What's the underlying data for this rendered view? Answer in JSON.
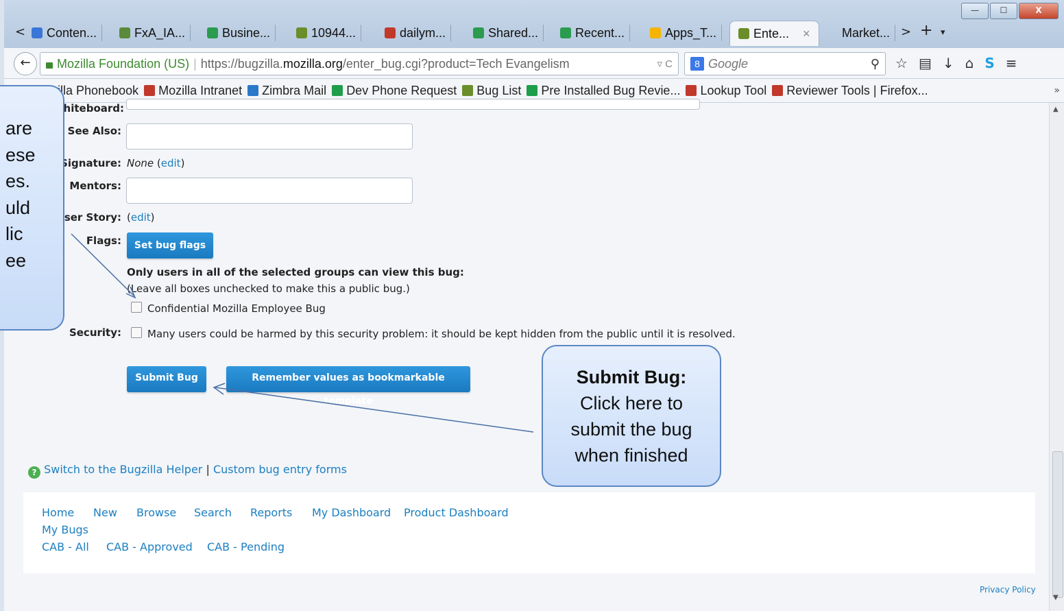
{
  "tabs": [
    {
      "label": "Conten...",
      "icon": "docs-icon",
      "color": "#3a76d8"
    },
    {
      "label": "FxA_IA...",
      "icon": "check-icon",
      "color": "#5a8a3a"
    },
    {
      "label": "Busine...",
      "icon": "drive-icon",
      "color": "#2a9b4f"
    },
    {
      "label": "10944...",
      "icon": "bugzilla-icon",
      "color": "#6a8e2a"
    },
    {
      "label": "dailym...",
      "icon": "mozilla-icon",
      "color": "#c0392b"
    },
    {
      "label": "Shared...",
      "icon": "drive-icon",
      "color": "#2a9b4f"
    },
    {
      "label": "Recent...",
      "icon": "drive-icon",
      "color": "#2a9b4f"
    },
    {
      "label": "Apps_T...",
      "icon": "slides-icon",
      "color": "#f4b400"
    },
    {
      "label": "Ente...",
      "icon": "bugzilla-icon",
      "color": "#6a8e2a",
      "active": true
    },
    {
      "label": "Market...",
      "icon": "",
      "color": ""
    }
  ],
  "tab_close": "×",
  "tab_controls": {
    "prev": "<",
    "next": ">",
    "new": "+",
    "list": "▾"
  },
  "window_controls": {
    "minimize": "—",
    "maximize": "☐",
    "close": "X"
  },
  "nav": {
    "security_label": "Mozilla Foundation (US)",
    "url_prefix": "https://bugzilla.",
    "url_domain": "mozilla.org",
    "url_path": "/enter_bug.cgi?product=Tech Evangelism",
    "reload": "▿ C",
    "search_placeholder": "Google",
    "search_engine": "8"
  },
  "bookmarks": [
    {
      "label": "Mozilla Phonebook",
      "icon": "mozilla-icon",
      "color": "#c0392b"
    },
    {
      "label": "Mozilla Intranet",
      "icon": "mozilla-icon",
      "color": "#c0392b"
    },
    {
      "label": "Zimbra Mail",
      "icon": "zimbra-icon",
      "color": "#2a78c8"
    },
    {
      "label": "Dev Phone Request",
      "icon": "sheet-icon",
      "color": "#1e9e4a"
    },
    {
      "label": "Bug List",
      "icon": "bugzilla-icon",
      "color": "#6a8e2a"
    },
    {
      "label": "Pre Installed Bug Revie...",
      "icon": "sheet-icon",
      "color": "#1e9e4a"
    },
    {
      "label": "Lookup Tool",
      "icon": "mozilla-icon",
      "color": "#c0392b"
    },
    {
      "label": "Reviewer Tools | Firefox...",
      "icon": "mozilla-icon",
      "color": "#c0392b"
    }
  ],
  "bookmarks_overflow": "»",
  "form": {
    "whiteboard_label": "Whiteboard:",
    "see_also_label": "See Also:",
    "crash_signature_label": "h Signature:",
    "crash_signature_value": "None",
    "edit_link": "edit",
    "mentors_label": "Mentors:",
    "user_story_label": "User Story:",
    "flags_label": "Flags:",
    "set_flags_button": "Set bug flags",
    "groups_heading": "Only users in all of the selected groups can view this bug:",
    "groups_note": "(Leave all boxes unchecked to make this a public bug.)",
    "confidential_label": "Confidential Mozilla Employee Bug",
    "security_label": "Security:",
    "security_text": "Many users could be harmed by this security problem: it should be kept hidden from the public until it is resolved.",
    "submit_button": "Submit Bug",
    "template_button": "Remember values as bookmarkable template"
  },
  "helper": {
    "switch_link": "Switch to the Bugzilla Helper",
    "separator": "|",
    "custom_link": "Custom bug entry forms"
  },
  "footer_links_row1": [
    "Home",
    "New",
    "Browse",
    "Search",
    "Reports",
    "My Dashboard",
    "Product Dashboard"
  ],
  "footer_links_row2": [
    "My Bugs"
  ],
  "footer_links_row3": [
    "CAB - All",
    "CAB - Approved",
    "CAB - Pending"
  ],
  "privacy_policy": "Privacy Policy",
  "callout_left_lines": [
    "are",
    "ese",
    "es.",
    "uld",
    "lic",
    "ee"
  ],
  "callout_right": {
    "title": "Submit Bug:",
    "lines": [
      "Click here to",
      "submit the bug",
      "when finished"
    ]
  }
}
